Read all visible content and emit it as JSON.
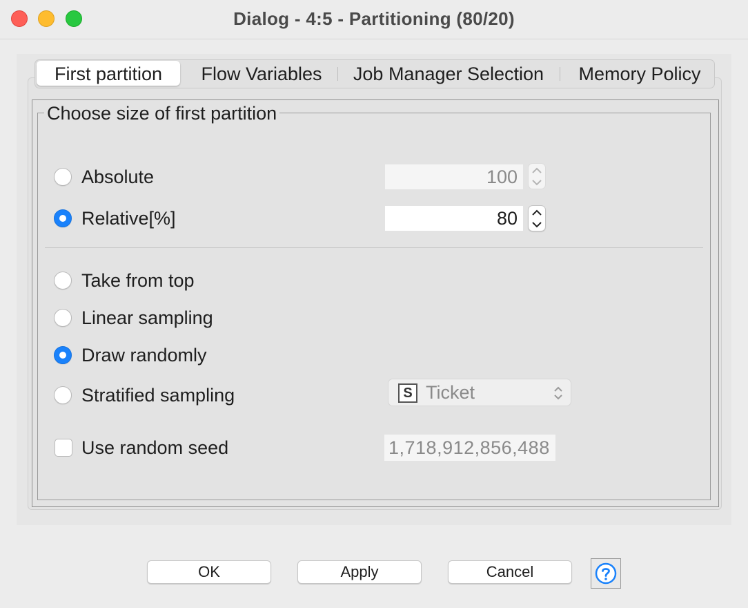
{
  "window": {
    "title": "Dialog - 4:5 - Partitioning (80/20)"
  },
  "tabs": [
    {
      "label": "First partition",
      "active": true
    },
    {
      "label": "Flow Variables",
      "active": false
    },
    {
      "label": "Job Manager Selection",
      "active": false
    },
    {
      "label": "Memory Policy",
      "active": false
    }
  ],
  "group": {
    "title": "Choose size of first partition"
  },
  "size": {
    "absolute": {
      "label": "Absolute",
      "value": "100",
      "selected": false,
      "enabled": false
    },
    "relative": {
      "label": "Relative[%]",
      "value": "80",
      "selected": true,
      "enabled": true
    }
  },
  "methods": {
    "take_from_top": {
      "label": "Take from top",
      "selected": false
    },
    "linear": {
      "label": "Linear sampling",
      "selected": false
    },
    "random": {
      "label": "Draw randomly",
      "selected": true
    },
    "stratified": {
      "label": "Stratified sampling",
      "selected": false,
      "column_type": "S",
      "column": "Ticket"
    }
  },
  "seed": {
    "label": "Use random seed",
    "checked": false,
    "value": "1,718,912,856,488"
  },
  "buttons": {
    "ok": "OK",
    "apply": "Apply",
    "cancel": "Cancel"
  },
  "colors": {
    "accent": "#1a82fb",
    "help": "#1a82fb"
  },
  "icons": {
    "spinner": "up-down-arrows",
    "help": "question-mark-circle",
    "combo": "chevron-up-down"
  }
}
